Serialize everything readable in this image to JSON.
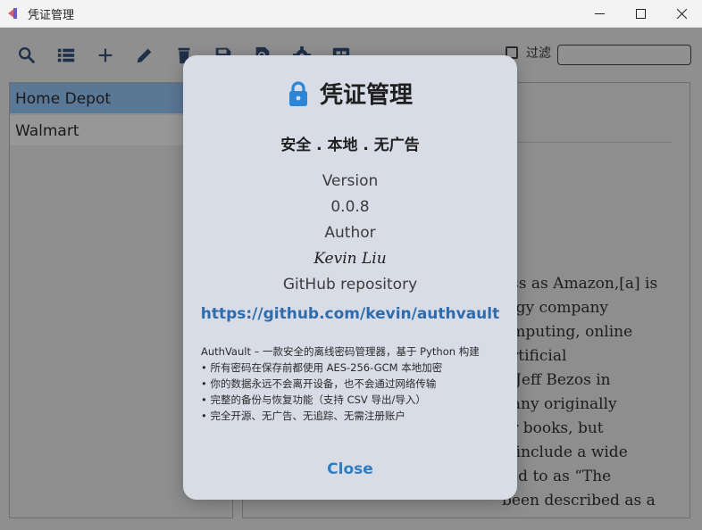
{
  "window": {
    "title": "凭证管理",
    "controls": [
      "minimize-icon",
      "maximize-icon",
      "close-icon"
    ]
  },
  "toolbar": {
    "icons": [
      "search-icon",
      "list-icon",
      "add-icon",
      "edit-icon",
      "delete-icon",
      "save-icon",
      "search-file-icon",
      "settings-icon",
      "dashboard-icon"
    ],
    "filter_label": "过滤",
    "filter_value": ""
  },
  "list": {
    "items": [
      {
        "label": "Home Depot",
        "selected": true
      },
      {
        "label": "Walmart",
        "selected": false
      }
    ]
  },
  "detail": {
    "lines": [
      "ess as Amazon,[a] is",
      "logy company",
      "omputing, online",
      "artificial",
      "y Jeff Bezos in",
      "pany originally",
      "or books, but",
      "o include a wide",
      "red to as “The",
      "been described as a"
    ]
  },
  "about_dialog": {
    "title": "凭证管理",
    "icon": "lock-icon",
    "tagline": "安全 . 本地 . 无广告",
    "version_label": "Version",
    "version_value": "0.0.8",
    "author_label": "Author",
    "author_value": "Kevin Liu",
    "repo_label": "GitHub repository",
    "repo_url": "https://github.com/kevin/authvault",
    "description": [
      "AuthVault – 一款安全的离线密码管理器，基于 Python 构建",
      "• 所有密码在保存前都使用 AES-256-GCM 本地加密",
      "• 你的数据永远不会离开设备，也不会通过网络传输",
      "• 完整的备份与恢复功能（支持 CSV 导出/导入）",
      "• 完全开源、无广告、无追踪、无需注册账户"
    ],
    "close_label": "Close"
  },
  "colors": {
    "accent": "#2f7cc0",
    "link": "#2f6cad",
    "lock": "#2a86d8",
    "dialog_bg": "#d8dce7",
    "overlay": "#8f8f8f"
  }
}
